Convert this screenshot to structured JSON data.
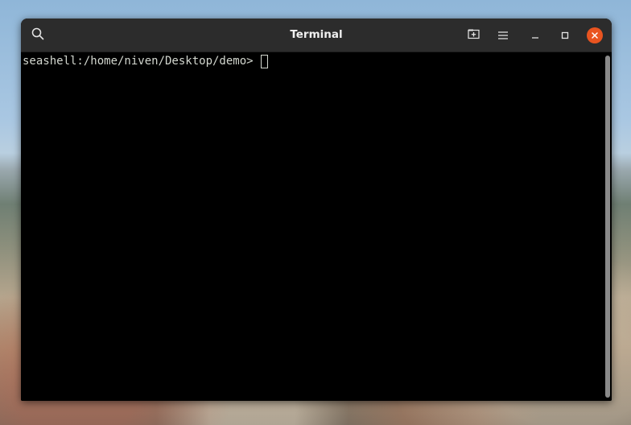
{
  "window": {
    "title": "Terminal"
  },
  "titlebar": {
    "buttons": [
      {
        "icon": "search-icon"
      },
      {
        "icon": "new-tab-icon"
      },
      {
        "icon": "hamburger-menu-icon"
      },
      {
        "icon": "minimize-icon"
      },
      {
        "icon": "maximize-icon"
      },
      {
        "icon": "close-icon"
      }
    ]
  },
  "terminal": {
    "prompt": "seashell:/home/niven/Desktop/demo>",
    "input": ""
  },
  "colors": {
    "titlebar_bg": "#2c2c2c",
    "terminal_bg": "#000000",
    "terminal_fg": "#d3d7cf",
    "close_button": "#e95420"
  }
}
